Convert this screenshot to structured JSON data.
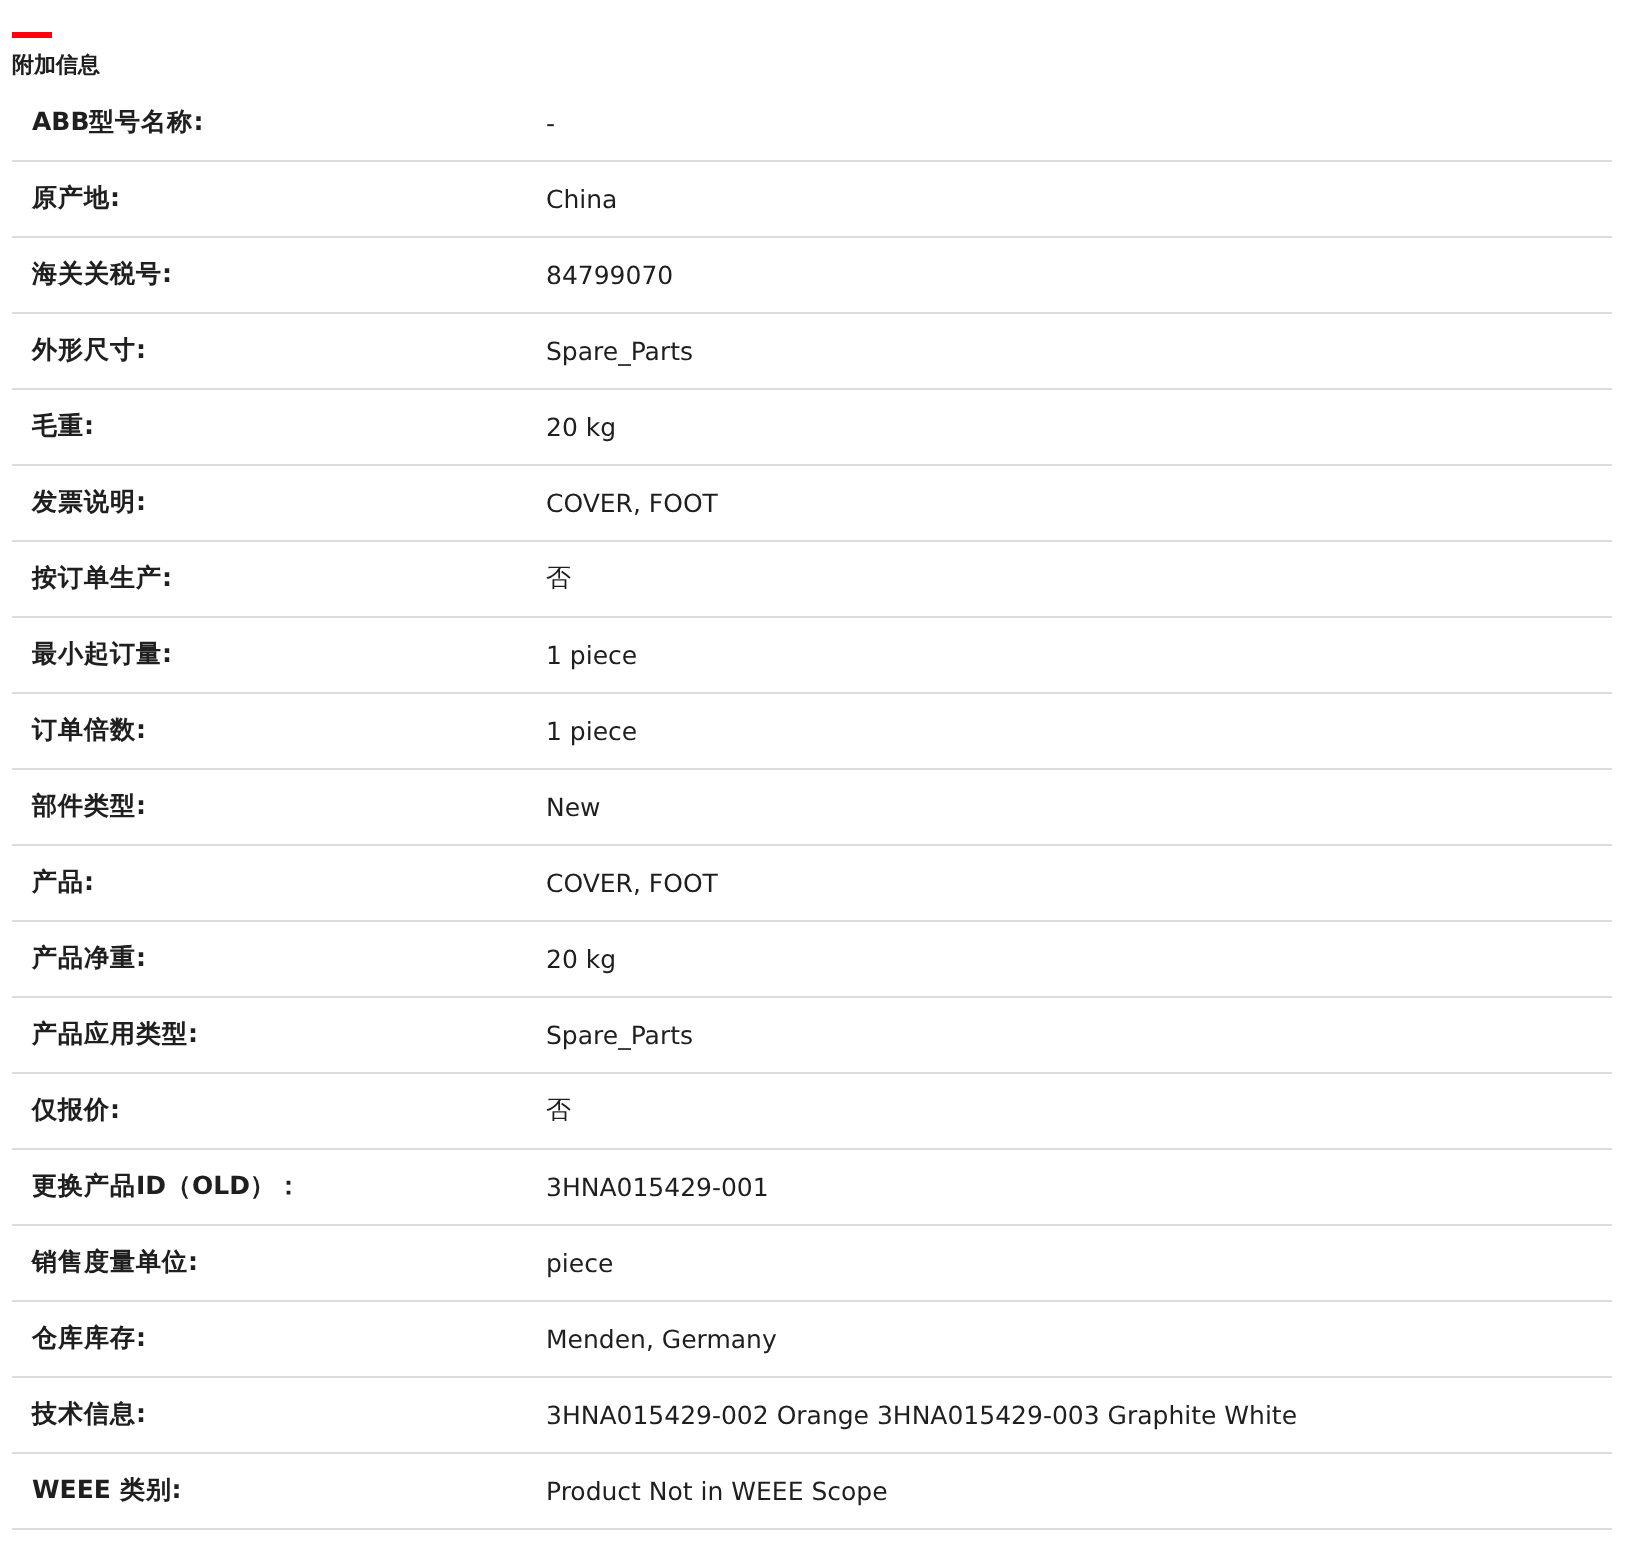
{
  "section": {
    "title": "附加信息"
  },
  "rows": [
    {
      "label": "ABB型号名称:",
      "value": "-"
    },
    {
      "label": "原产地:",
      "value": "China"
    },
    {
      "label": "海关关税号:",
      "value": "84799070"
    },
    {
      "label": "外形尺寸:",
      "value": "Spare_Parts"
    },
    {
      "label": "毛重:",
      "value": "20 kg"
    },
    {
      "label": "发票说明:",
      "value": "COVER, FOOT"
    },
    {
      "label": "按订单生产:",
      "value": "否"
    },
    {
      "label": "最小起订量:",
      "value": "1 piece"
    },
    {
      "label": "订单倍数:",
      "value": "1 piece"
    },
    {
      "label": "部件类型:",
      "value": "New"
    },
    {
      "label": "产品:",
      "value": "COVER, FOOT"
    },
    {
      "label": "产品净重:",
      "value": "20 kg"
    },
    {
      "label": "产品应用类型:",
      "value": "Spare_Parts"
    },
    {
      "label": "仅报价:",
      "value": "否"
    },
    {
      "label": "更换产品ID（OLD）：",
      "value": "3HNA015429-001"
    },
    {
      "label": "销售度量单位:",
      "value": "piece"
    },
    {
      "label": "仓库库存:",
      "value": "Menden, Germany"
    },
    {
      "label": "技术信息:",
      "value": "3HNA015429-002 Orange 3HNA015429-003 Graphite White"
    },
    {
      "label": "WEEE 类别:",
      "value": "Product Not in WEEE Scope"
    }
  ]
}
